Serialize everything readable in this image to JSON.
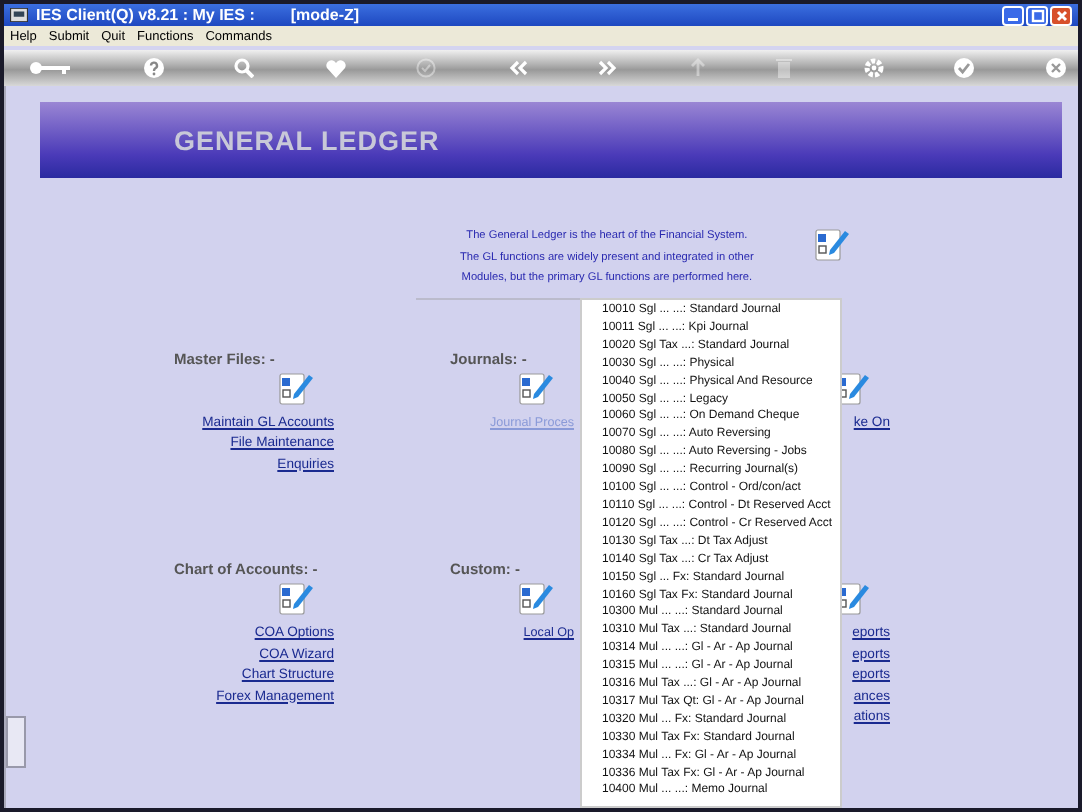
{
  "window": {
    "title": "IES Client(Q) v8.21 : My IES :",
    "mode": "[mode-Z]"
  },
  "menu": [
    "Help",
    "Submit",
    "Quit",
    "Functions",
    "Commands"
  ],
  "toolbar": [
    {
      "kind": "key",
      "disabled": false
    },
    {
      "kind": "help",
      "disabled": false
    },
    {
      "kind": "search",
      "disabled": false
    },
    {
      "kind": "heart",
      "disabled": false
    },
    {
      "kind": "check-circle",
      "disabled": true
    },
    {
      "kind": "back",
      "disabled": false
    },
    {
      "kind": "forward",
      "disabled": false
    },
    {
      "kind": "up",
      "disabled": true
    },
    {
      "kind": "trash",
      "disabled": true
    },
    {
      "kind": "gear",
      "disabled": false
    },
    {
      "kind": "check",
      "disabled": false
    },
    {
      "kind": "close",
      "disabled": false
    }
  ],
  "banner": {
    "title": "GENERAL LEDGER"
  },
  "intro": [
    "The General Ledger is the heart of the Financial System.",
    "The GL functions are widely present and integrated in other",
    "Modules, but the primary GL functions are performed here."
  ],
  "section_rows": [
    [
      {
        "title": "Master Files: -",
        "links": [
          {
            "label": "Maintain GL Accounts",
            "disabled": false
          },
          {
            "label": "File Maintenance",
            "disabled": false
          },
          {
            "label": "Enquiries",
            "disabled": false
          }
        ]
      },
      {
        "title": "Journals: -",
        "links": [
          {
            "label": "Journal Proces",
            "disabled": true
          }
        ]
      },
      {
        "links": [
          {
            "label": "ke On",
            "disabled": false
          }
        ]
      }
    ],
    [
      {
        "title": "Chart of Accounts: -",
        "links": [
          {
            "label": "COA Options",
            "disabled": false
          },
          {
            "label": "COA Wizard",
            "disabled": false
          },
          {
            "label": "Chart Structure",
            "disabled": false
          },
          {
            "label": "Forex Management",
            "disabled": false
          }
        ]
      },
      {
        "title": "Custom: -",
        "links": [
          {
            "label": "Local Op",
            "disabled": false
          }
        ]
      },
      {
        "links": [
          {
            "label": "eports",
            "disabled": false
          },
          {
            "label": "eports",
            "disabled": false
          },
          {
            "label": "eports",
            "disabled": false
          },
          {
            "label": "ances",
            "disabled": false
          },
          {
            "label": "ations",
            "disabled": false
          }
        ]
      }
    ]
  ],
  "dropdown": {
    "items": [
      "10010 Sgl ... ...: Standard Journal",
      "10011 Sgl ... ...: Kpi Journal",
      "10020 Sgl Tax ...: Standard Journal",
      "10030 Sgl ... ...: Physical",
      "10040 Sgl ... ...: Physical And Resource",
      "10050 Sgl ... ...: Legacy",
      "10060 Sgl ... ...: On Demand Cheque",
      "10070 Sgl ... ...: Auto Reversing",
      "10080 Sgl ... ...: Auto Reversing - Jobs",
      "10090 Sgl ... ...: Recurring Journal(s)",
      "10100 Sgl ... ...: Control - Ord/con/act",
      "10110 Sgl ... ...: Control - Dt Reserved Acct",
      "10120 Sgl ... ...: Control - Cr Reserved Acct",
      "10130 Sgl Tax ...: Dt Tax Adjust",
      "10140 Sgl Tax ...: Cr Tax Adjust",
      "10150 Sgl ... Fx: Standard Journal",
      "10160 Sgl Tax Fx: Standard Journal",
      "10300 Mul ... ...: Standard Journal",
      "10310 Mul Tax ...: Standard Journal",
      "10314 Mul ... ...: Gl - Ar - Ap Journal",
      "10315 Mul ... ...: Gl - Ar - Ap Journal",
      "10316 Mul Tax ...: Gl - Ar - Ap Journal",
      "10317 Mul Tax Qt: Gl - Ar - Ap Journal",
      "10320 Mul ... Fx: Standard Journal",
      "10330 Mul Tax Fx: Standard Journal",
      "10334 Mul ... Fx: Gl - Ar - Ap Journal",
      "10336 Mul Tax Fx: Gl - Ar - Ap Journal",
      "10400 Mul ... ...: Memo Journal"
    ]
  }
}
